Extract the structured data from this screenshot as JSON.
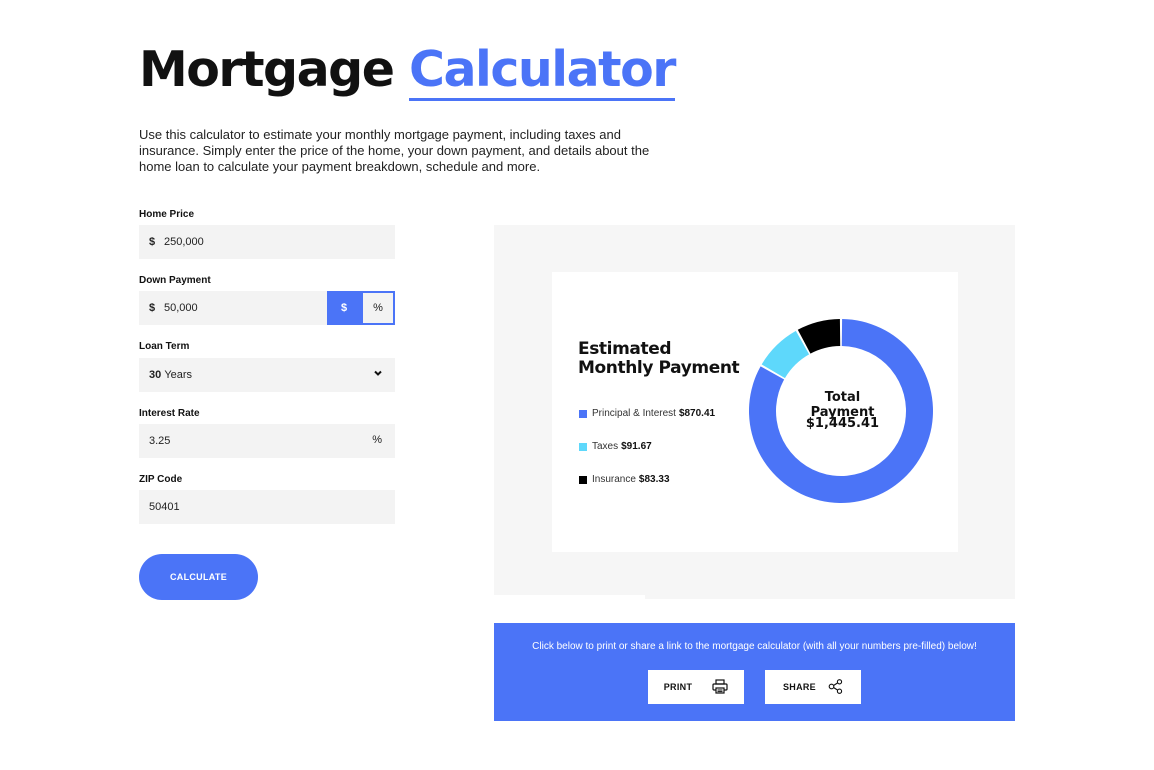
{
  "header": {
    "title_main": "Mortgage",
    "title_accent": "Calculator",
    "intro": "Use this calculator to estimate your monthly mortgage payment, including taxes and insurance. Simply enter the price of the home, your down payment, and details about the home loan to calculate your payment breakdown, schedule and more."
  },
  "form": {
    "home_price": {
      "label": "Home Price",
      "prefix": "$",
      "value": "250,000"
    },
    "down_payment": {
      "label": "Down Payment",
      "prefix": "$",
      "value": "50,000",
      "toggle_dollar": "$",
      "toggle_percent": "%",
      "selected_toggle": "$"
    },
    "loan_term": {
      "label": "Loan Term",
      "value_bold": "30",
      "value_unit": "Years",
      "icon": "chevron-down-icon"
    },
    "interest_rate": {
      "label": "Interest Rate",
      "value": "3.25",
      "suffix": "%"
    },
    "zip": {
      "label": "ZIP Code",
      "value": "50401"
    },
    "calculate_label": "CALCULATE"
  },
  "result": {
    "title": "Estimated Monthly Payment",
    "total_label": "Total Payment",
    "total_value": "$1,445.41",
    "breakdown": [
      {
        "label": "Principal & Interest",
        "value": "$870.41",
        "color": "#4b74f7"
      },
      {
        "label": "Taxes",
        "value": "$91.67",
        "color": "#5ed8fb"
      },
      {
        "label": "Insurance",
        "value": "$83.33",
        "color": "#000000"
      }
    ]
  },
  "chart_data": {
    "type": "pie",
    "categories": [
      "Principal & Interest",
      "Taxes",
      "Insurance"
    ],
    "values": [
      870.41,
      91.67,
      83.33
    ],
    "colors": [
      "#4b74f7",
      "#5ed8fb",
      "#000000"
    ],
    "title": "Estimated Monthly Payment",
    "center_label": "Total Payment",
    "center_value": "$1,445.41"
  },
  "share": {
    "text": "Click below to print or share a link to the mortgage calculator (with all your numbers pre-filled) below!",
    "print_label": "PRINT",
    "print_icon": "printer-icon",
    "share_label": "SHARE",
    "share_icon": "share-icon"
  }
}
